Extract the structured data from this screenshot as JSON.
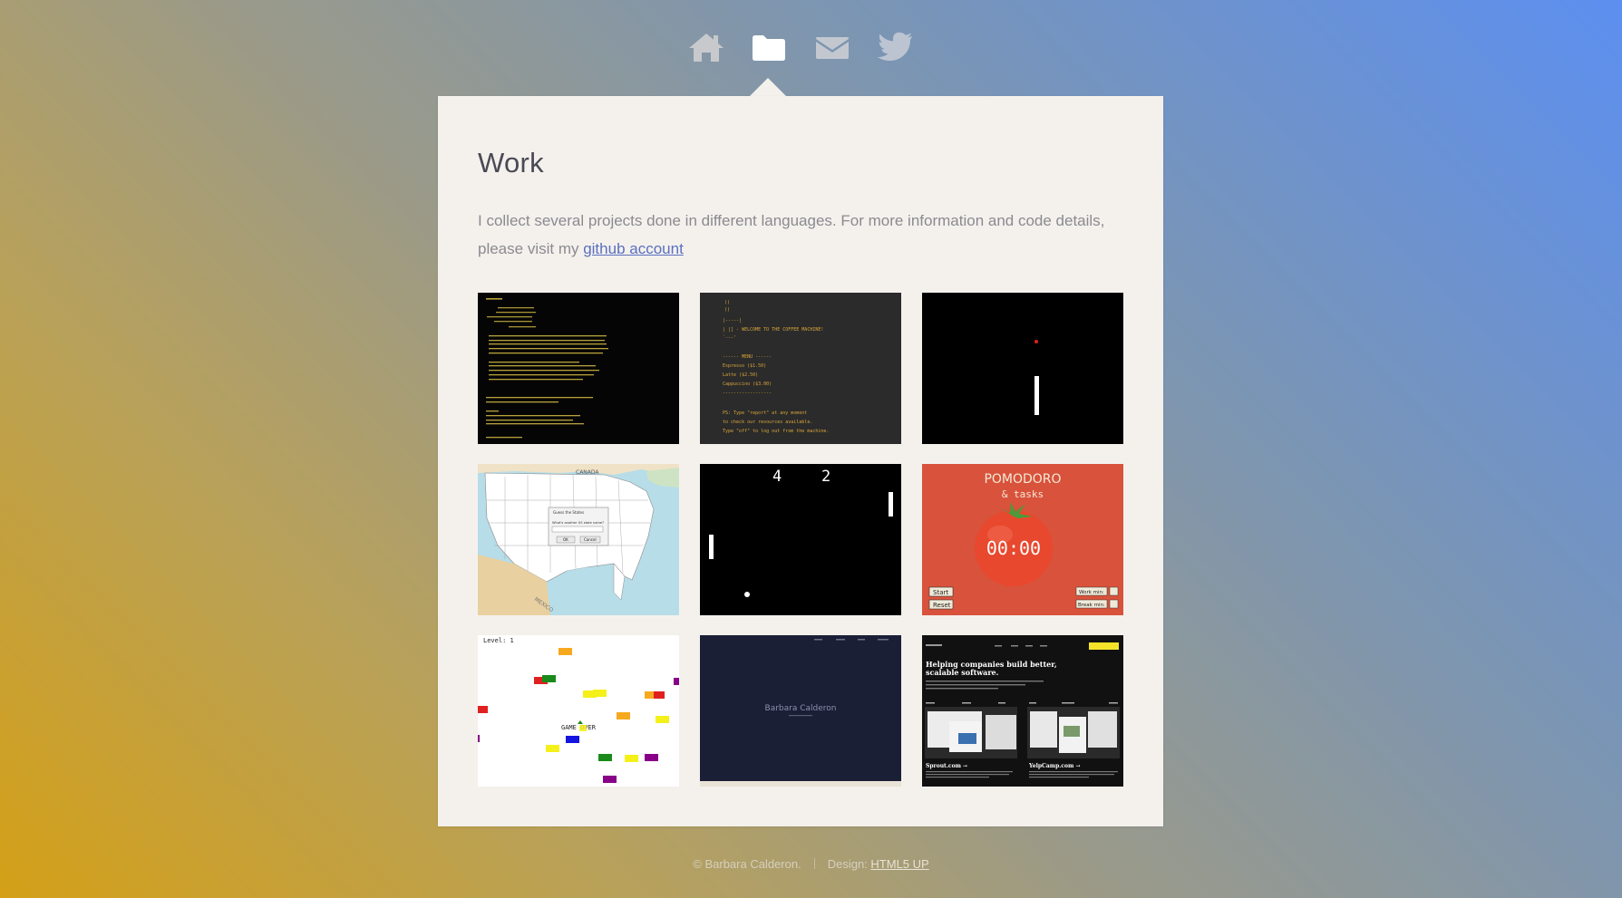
{
  "nav": {
    "items": [
      {
        "icon": "home-icon"
      },
      {
        "icon": "folder-icon",
        "active": true
      },
      {
        "icon": "envelope-icon"
      },
      {
        "icon": "twitter-icon"
      }
    ]
  },
  "work": {
    "title": "Work",
    "intro_before": "I collect several projects done in different languages. For more information and code details, please visit my ",
    "github_link": "github account"
  },
  "projects": {
    "coffee": {
      "lines": [
        " ))",
        " ((",
        "|-----|",
        "|   |] - WELCOME TO THE COFFEE MACHINE!",
        " `---'",
        "------ MENU ------",
        "Espresso ($1.50)",
        "Latte ($2.50)",
        "Cappuccino ($3.00)",
        "------------------",
        "PS: Type \"report\" at any moment",
        "to check our resources available.",
        "Type \"off\" to log out from the machine."
      ]
    },
    "states": {
      "label_top": "CANADA",
      "label_bottom": "MEXICO",
      "dialog_title": "Guess the States",
      "dialog_prompt": "What's another US state name?",
      "ok": "OK",
      "cancel": "Cancel"
    },
    "pong": {
      "score_left": "4",
      "score_right": "2"
    },
    "pomodoro": {
      "title": "POMODORO",
      "subtitle": "& tasks",
      "timer": "00:00",
      "start": "Start",
      "reset": "Reset",
      "work_min": "Work min:",
      "break_min": "Break min:"
    },
    "turtle": {
      "level": "Level: 1",
      "game_over": "GAME OVER"
    },
    "portfolio": {
      "name": "Barbara Calderon"
    },
    "agency": {
      "headline_1": "Helping companies build better,",
      "headline_2": "scalable software.",
      "card_1": "Sprout.com →",
      "card_2": "YelpCamp.com →"
    }
  },
  "footer": {
    "copyright": "© Barbara Calderon.",
    "design_label": "Design:",
    "design_link": "HTML5 UP"
  },
  "colors": {
    "panel": "#f4f1ed",
    "link": "#5a6fc0",
    "nav_icon": "#bfc4cc",
    "pomodoro_bg": "#e0533e"
  }
}
